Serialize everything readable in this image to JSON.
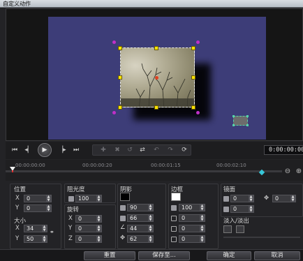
{
  "window": {
    "title": "自定义动作"
  },
  "transport": {
    "timecode": "0:00:00:00",
    "buttons": [
      "skip-start",
      "step-back",
      "play",
      "step-forward",
      "skip-end"
    ]
  },
  "timeline": {
    "ruler": [
      "00:00:00:00",
      "00:00:00:20",
      "00:00:01:15",
      "00:00:02:10"
    ]
  },
  "panel": {
    "position": {
      "label": "位置",
      "x": "0",
      "y": "0"
    },
    "size": {
      "label": "大小",
      "x": "34",
      "y": "50"
    },
    "opacity": {
      "label": "阻光度",
      "value": "100"
    },
    "rotation": {
      "label": "旋转",
      "x": "0",
      "y": "0",
      "z": "0"
    },
    "shadow": {
      "label": "阴影",
      "color": "#000000",
      "opacity": "90",
      "blur": "66",
      "angle": "44",
      "distance": "62"
    },
    "border": {
      "label": "边框",
      "color": "#ffffff",
      "opacity": "100",
      "size": "0",
      "v2": "0",
      "v3": "0"
    },
    "mirror": {
      "label": "镜面",
      "v1": "0",
      "v2": "0",
      "v3": "0",
      "move": "0"
    },
    "fade": {
      "label": "淡入/淡出"
    }
  },
  "footer": {
    "reset": "重置",
    "save_as": "保存至...",
    "ok": "确定",
    "cancel": "取消"
  },
  "colors": {
    "stage": "#3d3d78",
    "handle": "#ffe600",
    "corner_handle": "#c030c8",
    "keyframe": "#37c7d8"
  }
}
